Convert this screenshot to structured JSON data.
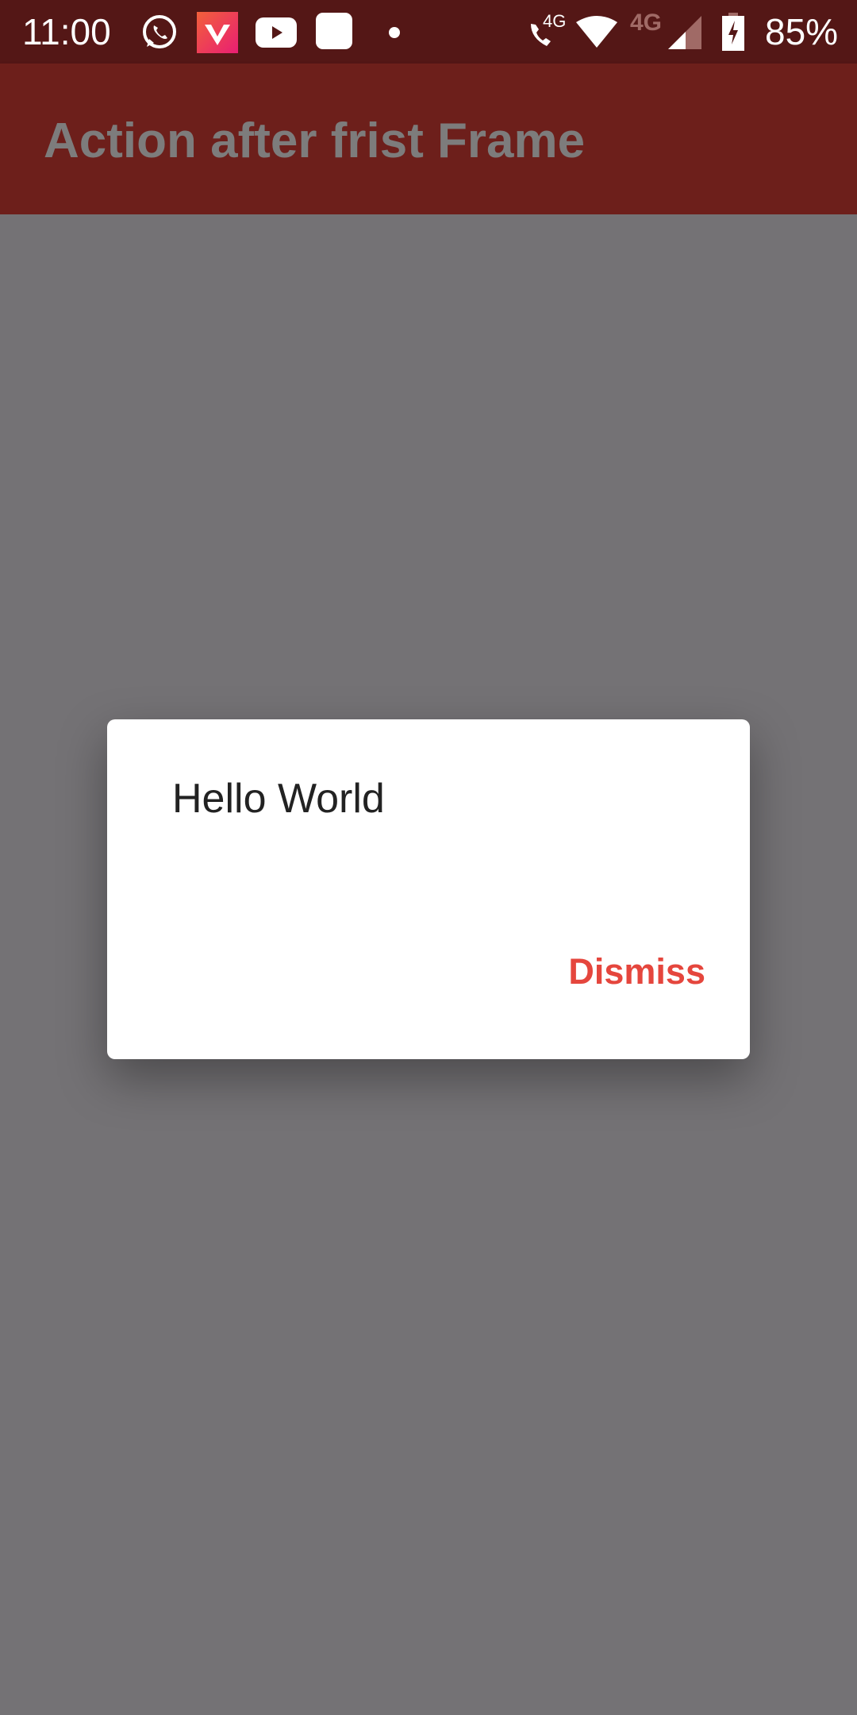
{
  "status_bar": {
    "time": "11:00",
    "notification_icons": [
      "whatsapp-icon",
      "vidmate-icon",
      "youtube-icon",
      "app-icon",
      "dot-icon"
    ],
    "call_network_label": "4G",
    "mobile_network_label": "4G",
    "battery_percent": "85%",
    "battery_level": 0.85
  },
  "app_bar": {
    "title": "Action after frist Frame",
    "color": "#6d1f1b"
  },
  "dialog": {
    "message": "Hello World",
    "action_label": "Dismiss",
    "action_color": "#e5463d"
  }
}
